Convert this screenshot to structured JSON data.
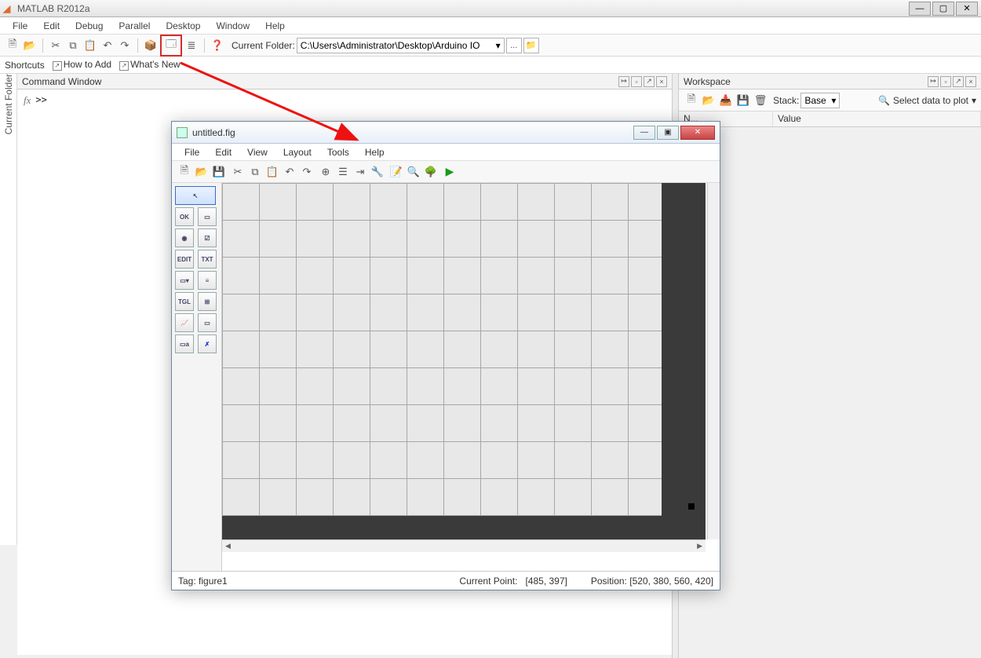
{
  "os": {
    "title": "MATLAB R2012a",
    "min": "—",
    "max": "▢",
    "close": "✕"
  },
  "menu": {
    "items": [
      "File",
      "Edit",
      "Debug",
      "Parallel",
      "Desktop",
      "Window",
      "Help"
    ]
  },
  "toolbar": {
    "folder_label": "Current Folder:",
    "path": "C:\\Users\\Administrator\\Desktop\\Arduino IO",
    "dropdown_arrow": "▾",
    "browse": "...",
    "up": "📁"
  },
  "shortcuts": {
    "label": "Shortcuts",
    "add": "How to Add",
    "whatsnew": "What's New"
  },
  "vrail": {
    "label": "Current Folder"
  },
  "cmdwin": {
    "title": "Command Window",
    "fx": "fx",
    "prompt": ">>"
  },
  "workspace": {
    "title": "Workspace",
    "stack_label": "Stack:",
    "stack_value": "Base",
    "select_plot": "Select data to plot",
    "col_name": "N...",
    "col_value": "Value"
  },
  "guide": {
    "title": "untitled.fig",
    "min": "—",
    "max": "▣",
    "close": "✕",
    "menu": [
      "File",
      "Edit",
      "View",
      "Layout",
      "Tools",
      "Help"
    ],
    "run": "▶",
    "palette": {
      "select_arrow": "↖",
      "push": "OK",
      "slider": "▭",
      "radio": "◉",
      "check": "☑",
      "edit": "EDIT",
      "text": "TXT",
      "popup": "▭▾",
      "list": "≡",
      "toggle": "TGL",
      "table": "⊞",
      "axes": "📈",
      "panel": "▭",
      "bgroup": "▭a",
      "activex": "✗"
    },
    "status": {
      "tag_label": "Tag:",
      "tag_value": "figure1",
      "cp_label": "Current Point:",
      "cp_value": "[485, 397]",
      "pos_label": "Position:",
      "pos_value": "[520, 380, 560, 420]"
    }
  }
}
